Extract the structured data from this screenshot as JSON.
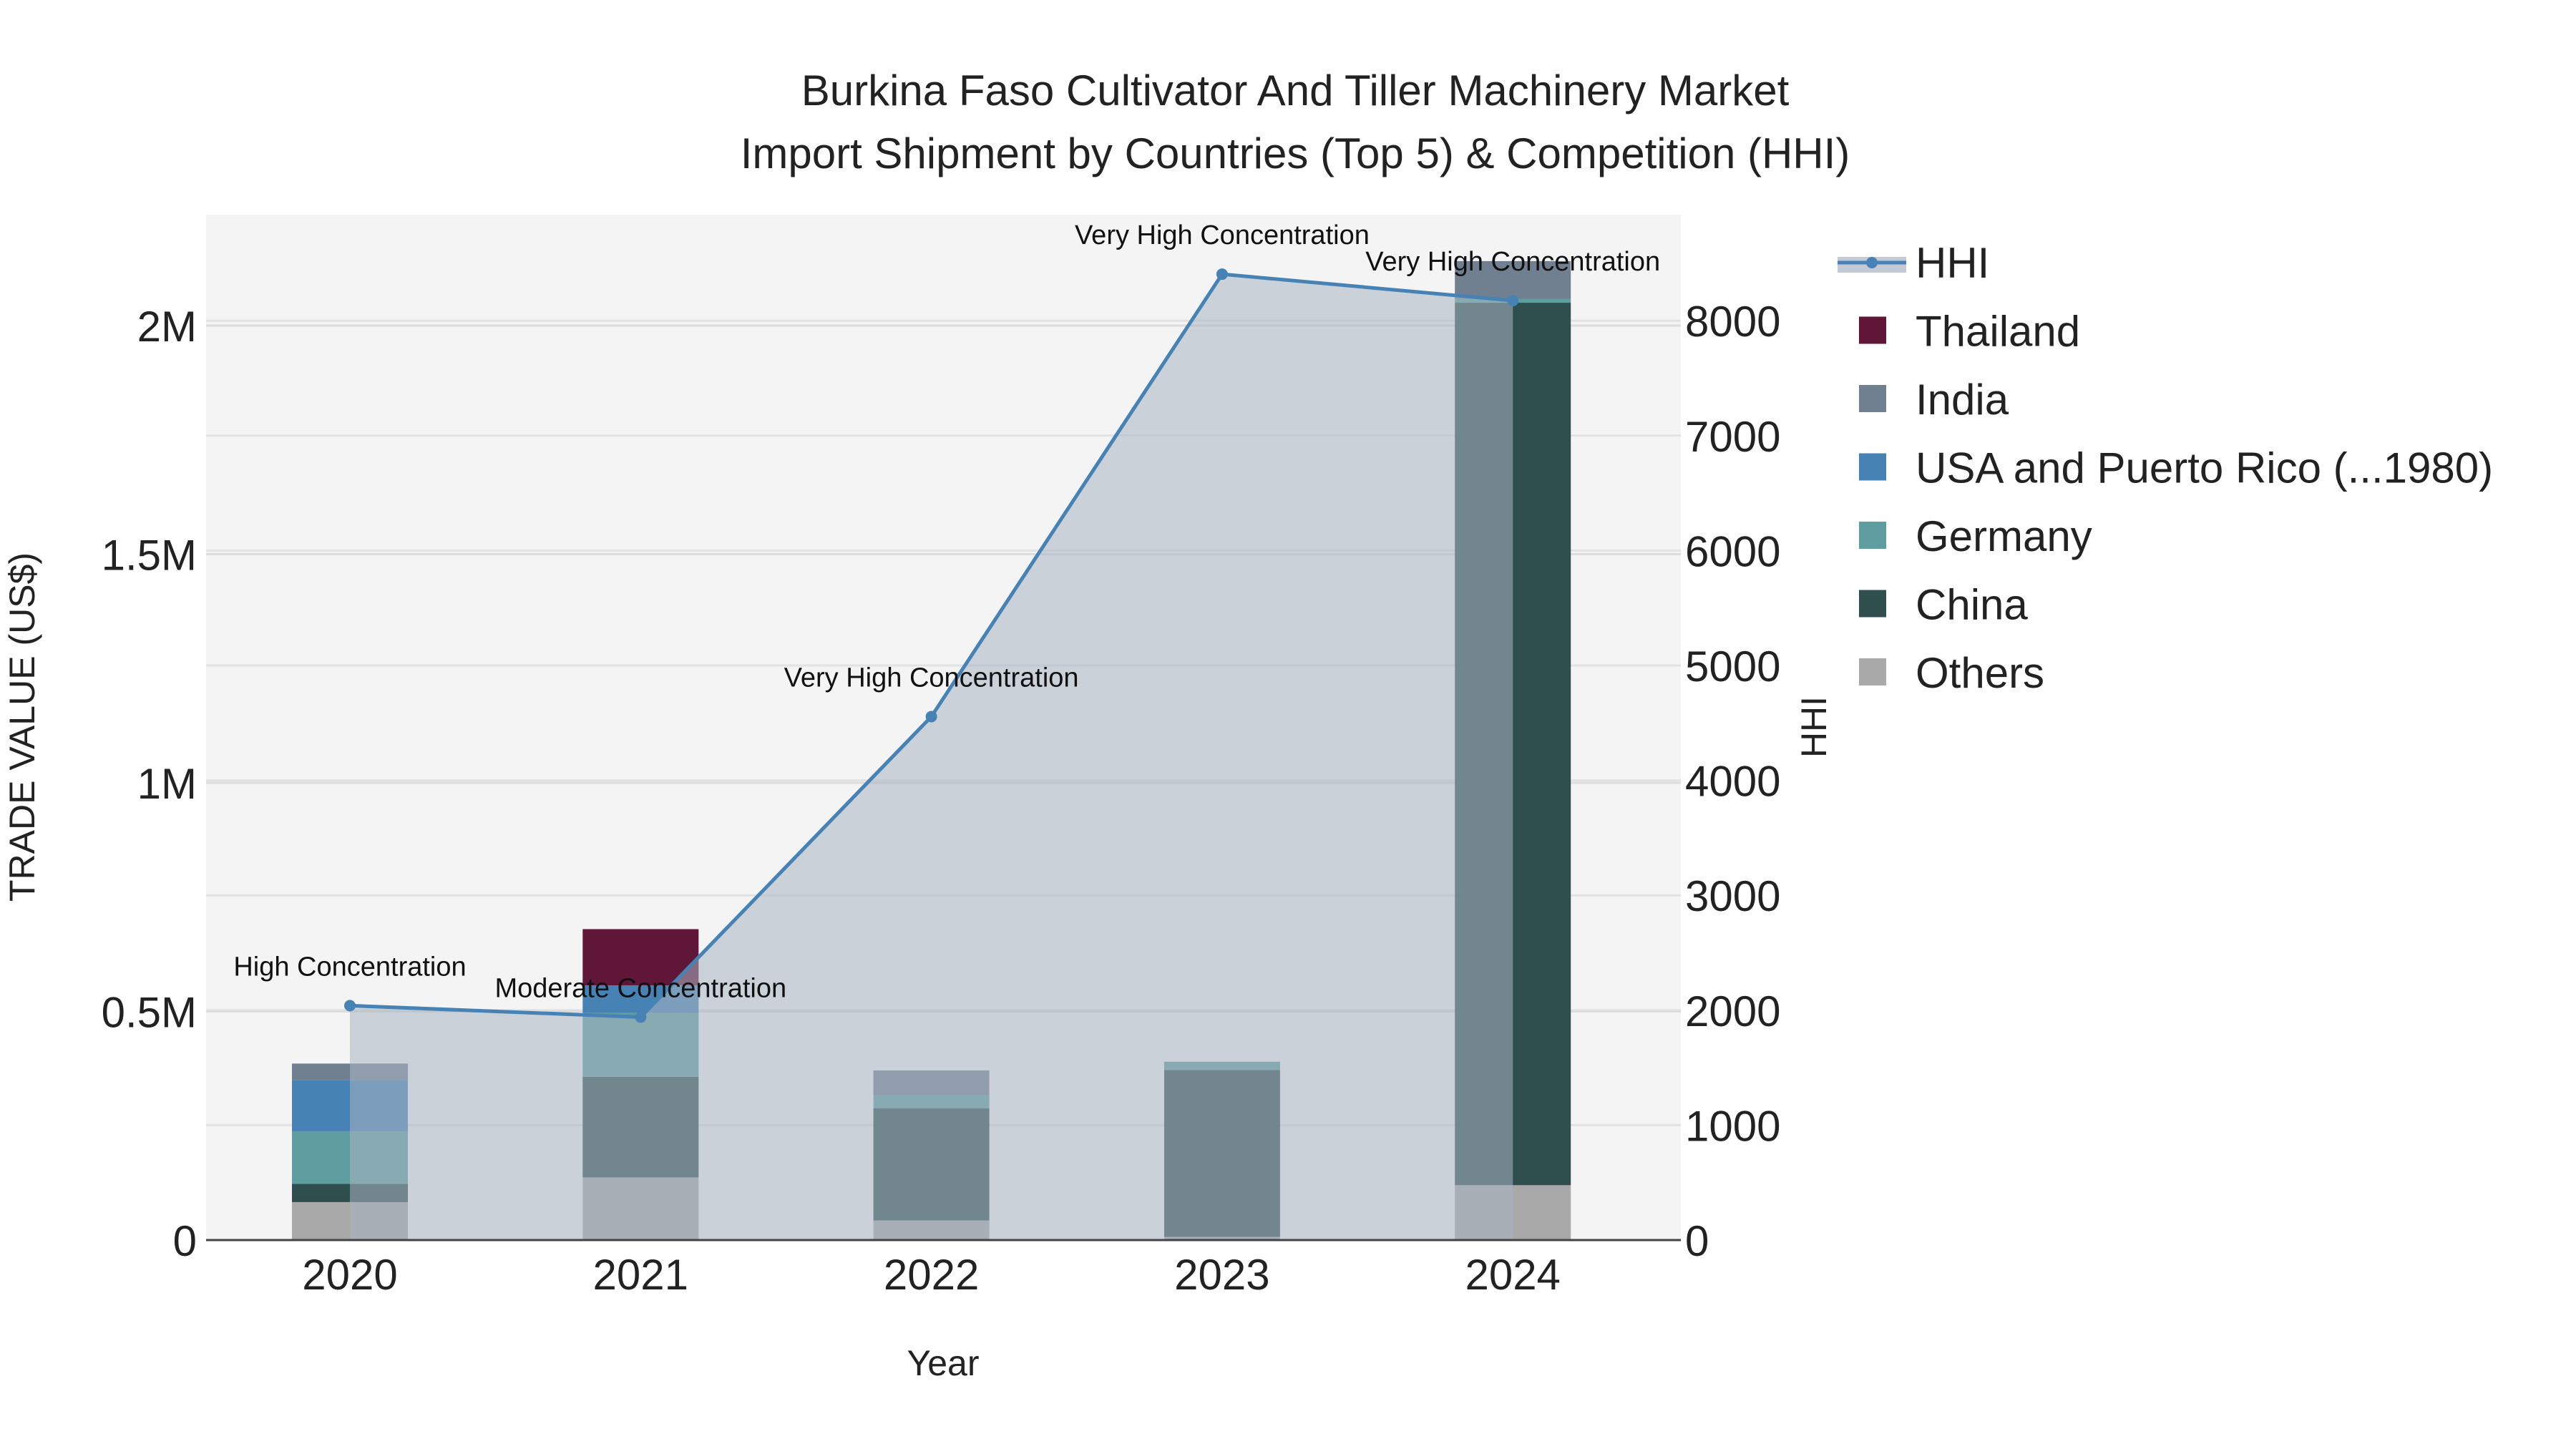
{
  "chart_data": {
    "type": "bar",
    "title": "Burkina Faso Cultivator And Tiller Machinery Market",
    "subtitle": "Import Shipment by Countries (Top 5) & Competition (HHI)",
    "xlabel": "Year",
    "ylabel": "TRADE VALUE (US$)",
    "y2label": "HHI",
    "categories": [
      "2020",
      "2021",
      "2022",
      "2023",
      "2024"
    ],
    "ylim": [
      0,
      2230000
    ],
    "y2lim": [
      0,
      8950
    ],
    "yticks": [
      {
        "v": 0,
        "label": "0"
      },
      {
        "v": 500000,
        "label": "0.5M"
      },
      {
        "v": 1000000,
        "label": "1M"
      },
      {
        "v": 1500000,
        "label": "1.5M"
      },
      {
        "v": 2000000,
        "label": "2M"
      }
    ],
    "y2ticks": [
      0,
      1000,
      2000,
      3000,
      4000,
      5000,
      6000,
      7000,
      8000
    ],
    "grid": true,
    "legend_position": "right",
    "series": [
      {
        "name": "Others",
        "color": "#a9a9a9",
        "values": [
          83000,
          137000,
          43000,
          7000,
          120000
        ]
      },
      {
        "name": "China",
        "color": "#2f4f4f",
        "values": [
          40000,
          220000,
          245000,
          365000,
          1930000
        ]
      },
      {
        "name": "Germany",
        "color": "#5f9ea0",
        "values": [
          115000,
          140000,
          29000,
          18000,
          8000
        ]
      },
      {
        "name": "USA and Puerto Rico (...1980)",
        "color": "#4682b4",
        "values": [
          112000,
          60000,
          0,
          0,
          0
        ]
      },
      {
        "name": "India",
        "color": "#708090",
        "values": [
          36000,
          0,
          54000,
          0,
          83000
        ]
      },
      {
        "name": "Thailand",
        "color": "#5f1637",
        "values": [
          0,
          123000,
          0,
          0,
          0
        ]
      }
    ],
    "hhi": {
      "name": "HHI",
      "color": "#4682b4",
      "values": [
        2040,
        1940,
        4555,
        8405,
        8175
      ],
      "annotations": [
        "High Concentration",
        "Moderate Concentration",
        "Very High Concentration",
        "Very High Concentration",
        "Very High Concentration"
      ]
    },
    "legend_order": [
      "HHI",
      "Thailand",
      "India",
      "USA and Puerto Rico (...1980)",
      "Germany",
      "China",
      "Others"
    ]
  }
}
